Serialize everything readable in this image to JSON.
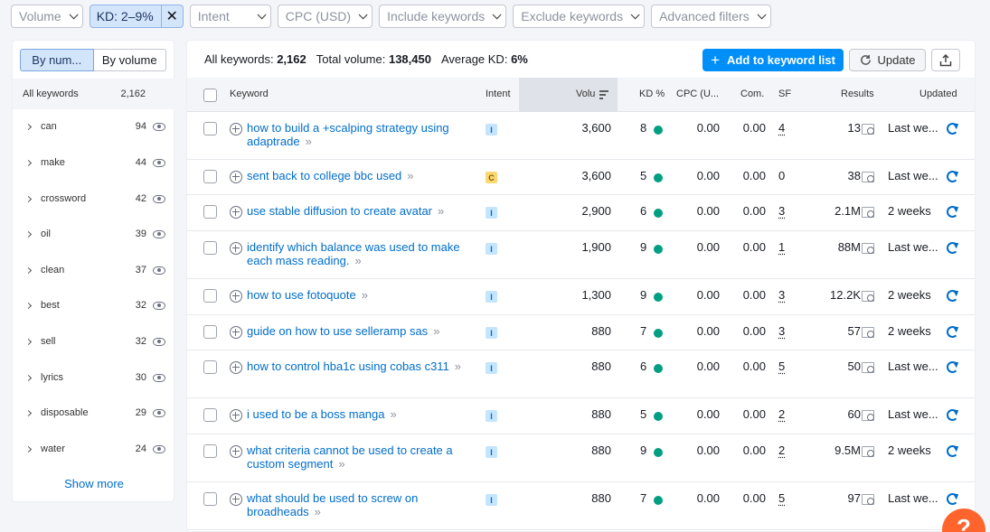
{
  "filters": [
    {
      "label": "Volume",
      "active": false
    },
    {
      "label": "KD: 2–9%",
      "active": true
    },
    {
      "label": "Intent",
      "active": false
    },
    {
      "label": "CPC (USD)",
      "active": false
    },
    {
      "label": "Include keywords",
      "active": false
    },
    {
      "label": "Exclude keywords",
      "active": false
    },
    {
      "label": "Advanced filters",
      "active": false
    }
  ],
  "sidebar": {
    "toggle": {
      "by_number": "By num...",
      "by_volume": "By volume"
    },
    "all_keywords_label": "All keywords",
    "all_keywords_count": "2,162",
    "groups": [
      {
        "word": "can",
        "count": "94"
      },
      {
        "word": "make",
        "count": "44"
      },
      {
        "word": "crossword",
        "count": "42"
      },
      {
        "word": "oil",
        "count": "39"
      },
      {
        "word": "clean",
        "count": "37"
      },
      {
        "word": "best",
        "count": "32"
      },
      {
        "word": "sell",
        "count": "32"
      },
      {
        "word": "lyrics",
        "count": "30"
      },
      {
        "word": "disposable",
        "count": "29"
      },
      {
        "word": "water",
        "count": "24"
      }
    ],
    "show_more": "Show more"
  },
  "summary": {
    "all_keywords_label": "All keywords:",
    "all_keywords_value": "2,162",
    "total_volume_label": "Total volume:",
    "total_volume_value": "138,450",
    "avg_kd_label": "Average KD:",
    "avg_kd_value": "6%"
  },
  "toolbar": {
    "add_label": "Add to keyword list",
    "update_label": "Update"
  },
  "columns": {
    "keyword": "Keyword",
    "intent": "Intent",
    "volume": "Volu",
    "kd": "KD %",
    "cpc": "CPC (U...",
    "com": "Com.",
    "sf": "SF",
    "results": "Results",
    "updated": "Updated"
  },
  "rows": [
    {
      "keyword": "how to build a +scalping strategy using adaptrade",
      "intent": "I",
      "volume": "3,600",
      "kd": "8",
      "cpc": "0.00",
      "com": "0.00",
      "sf": "4",
      "results": "13",
      "updated": "Last we..."
    },
    {
      "keyword": "sent back to college bbc used",
      "intent": "C",
      "volume": "3,600",
      "kd": "5",
      "cpc": "0.00",
      "com": "0.00",
      "sf": "0",
      "results": "38",
      "updated": "Last we..."
    },
    {
      "keyword": "use stable diffusion to create avatar",
      "intent": "I",
      "volume": "2,900",
      "kd": "6",
      "cpc": "0.00",
      "com": "0.00",
      "sf": "3",
      "results": "2.1M",
      "updated": "2 weeks"
    },
    {
      "keyword": "identify which balance was used to make each mass reading.",
      "intent": "I",
      "volume": "1,900",
      "kd": "9",
      "cpc": "0.00",
      "com": "0.00",
      "sf": "1",
      "results": "88M",
      "updated": "Last we..."
    },
    {
      "keyword": "how to use fotoquote",
      "intent": "I",
      "volume": "1,300",
      "kd": "9",
      "cpc": "0.00",
      "com": "0.00",
      "sf": "3",
      "results": "12.2K",
      "updated": "2 weeks"
    },
    {
      "keyword": "guide on how to use selleramp sas",
      "intent": "I",
      "volume": "880",
      "kd": "7",
      "cpc": "0.00",
      "com": "0.00",
      "sf": "3",
      "results": "57",
      "updated": "2 weeks"
    },
    {
      "keyword": "how to control hba1c using cobas c311",
      "intent": "I",
      "volume": "880",
      "kd": "6",
      "cpc": "0.00",
      "com": "0.00",
      "sf": "5",
      "results": "50",
      "updated": "Last we..."
    },
    {
      "keyword": "i used to be a boss manga",
      "intent": "I",
      "volume": "880",
      "kd": "5",
      "cpc": "0.00",
      "com": "0.00",
      "sf": "2",
      "results": "60",
      "updated": "Last we..."
    },
    {
      "keyword": "what criteria cannot be used to create a custom segment",
      "intent": "I",
      "volume": "880",
      "kd": "9",
      "cpc": "0.00",
      "com": "0.00",
      "sf": "2",
      "results": "9.5M",
      "updated": "2 weeks"
    },
    {
      "keyword": "what should be used to screw on broadheads",
      "intent": "I",
      "volume": "880",
      "kd": "7",
      "cpc": "0.00",
      "com": "0.00",
      "sf": "5",
      "results": "97",
      "updated": "Last we..."
    }
  ],
  "colors": {
    "accent": "#008ff8",
    "link": "#006dca",
    "kd_dot": "#009f81",
    "help": "#ff642d"
  },
  "help_label": "?"
}
